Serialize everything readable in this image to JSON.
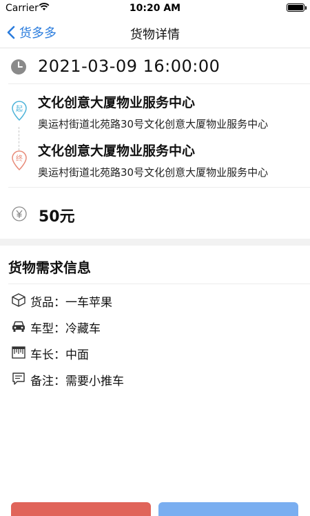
{
  "status_bar": {
    "carrier": "Carrier",
    "time": "10:20 AM"
  },
  "nav": {
    "back_label": "货多多",
    "title": "货物详情"
  },
  "shipment": {
    "datetime": "2021-03-09 16:00:00",
    "start": {
      "marker": "起",
      "name": "文化创意大厦物业服务中心",
      "address": "奥运村街道北苑路30号文化创意大厦物业服务中心"
    },
    "end": {
      "marker": "终",
      "name": "文化创意大厦物业服务中心",
      "address": "奥运村街道北苑路30号文化创意大厦物业服务中心"
    },
    "price": "50元"
  },
  "requirements": {
    "title": "货物需求信息",
    "items": [
      {
        "icon": "box-icon",
        "text": "货品：一车苹果"
      },
      {
        "icon": "car-icon",
        "text": "车型：冷藏车"
      },
      {
        "icon": "ruler-icon",
        "text": "车长：中面"
      },
      {
        "icon": "comment-icon",
        "text": "备注：需要小推车"
      }
    ]
  },
  "colors": {
    "accent": "#2a7cdd",
    "start_pin": "#4cb3d9",
    "end_pin": "#e88a78",
    "left_button": "#e0645a",
    "right_button": "#7aaef0"
  }
}
